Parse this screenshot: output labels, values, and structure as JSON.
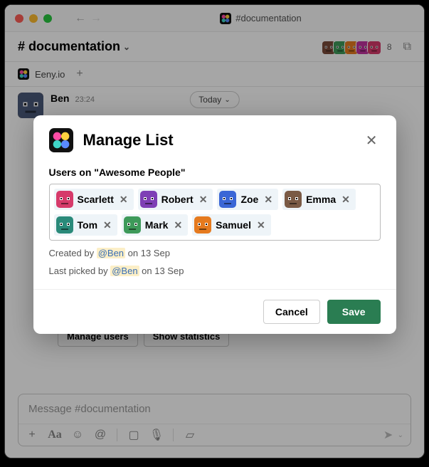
{
  "window": {
    "channel_hash": "#documentation",
    "app_name": "Eeny.io"
  },
  "header": {
    "channel_name": "# documentation",
    "member_count": "8",
    "avatar_colors": [
      "#7a4a3a",
      "#3e9a5a",
      "#e57a1f",
      "#c1329e",
      "#d63a6a"
    ]
  },
  "today_pill": "Today",
  "message": {
    "author": "Ben",
    "time": "23:24"
  },
  "action_buttons": {
    "manage": "Manage users",
    "stats": "Show statistics"
  },
  "composer": {
    "placeholder": "Message #documentation"
  },
  "modal": {
    "title": "Manage List",
    "subtitle": "Users on \"Awesome People\"",
    "chips": [
      {
        "name": "Scarlett",
        "color": "#d63a6a"
      },
      {
        "name": "Robert",
        "color": "#7e3fb5"
      },
      {
        "name": "Zoe",
        "color": "#3a66d6"
      },
      {
        "name": "Emma",
        "color": "#7a5a45"
      },
      {
        "name": "Tom",
        "color": "#2a8a7a"
      },
      {
        "name": "Mark",
        "color": "#3e9a5a"
      },
      {
        "name": "Samuel",
        "color": "#e57a1f"
      }
    ],
    "created_prefix": "Created by ",
    "created_mention": "@Ben",
    "created_suffix": " on 13 Sep",
    "picked_prefix": "Last picked by ",
    "picked_mention": "@Ben",
    "picked_suffix": " on 13 Sep",
    "cancel": "Cancel",
    "save": "Save"
  }
}
